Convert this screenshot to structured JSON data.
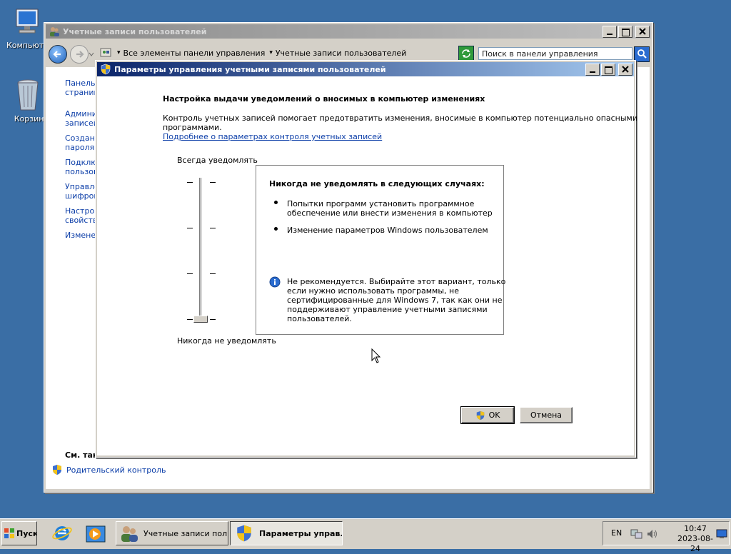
{
  "desktop": {
    "icons": [
      {
        "label": "Компьютер"
      },
      {
        "label": "Корзина"
      }
    ]
  },
  "cp_window": {
    "title": "Учетные записи пользователей",
    "breadcrumb": [
      "Все элементы панели управления",
      "Учетные записи пользователей"
    ],
    "search_placeholder": "Поиск в панели управления",
    "sidebar": [
      {
        "line1": "Панель",
        "line2": "страниц"
      },
      {
        "line1": "Админис",
        "line2": "записей"
      },
      {
        "line1": "Создани",
        "line2": "пароля"
      },
      {
        "line1": "Подклю",
        "line2": "пользов"
      },
      {
        "line1": "Управле",
        "line2": "шифров"
      },
      {
        "line1": "Настрой",
        "line2": "свойств"
      },
      {
        "line1": "Изменен",
        "line2": ""
      }
    ],
    "see_also": "См. так",
    "parental": "Родительский контроль"
  },
  "uac_dialog": {
    "title": "Параметры управления учетными записями пользователей",
    "heading": "Настройка выдачи уведомлений о вносимых в компьютер изменениях",
    "desc_line1": "Контроль учетных записей помогает предотвратить изменения, вносимые в компьютер потенциально опасными",
    "desc_line2": "программами.",
    "more_link": "Подробнее о параметрах контроля учетных записей",
    "slider_top": "Всегда уведомлять",
    "slider_bottom": "Никогда не уведомлять",
    "slider_level": 0,
    "slider_levels": 4,
    "info_title": "Никогда не уведомлять в следующих случаях:",
    "bullet1_line1": "Попытки программ установить программное",
    "bullet1_line2": "обеспечение или внести изменения в компьютер",
    "bullet2": "Изменение параметров Windows пользователем",
    "note_line1": "Не рекомендуется. Выбирайте этот вариант, только",
    "note_line2": "если нужно использовать программы, не",
    "note_line3": "сертифицированные для Windows 7, так как они не",
    "note_line4": "поддерживают управление учетными записями",
    "note_line5": "пользователей.",
    "ok": "OK",
    "cancel": "Отмена"
  },
  "taskbar": {
    "start": "Пуск",
    "tasks": [
      {
        "label": "Учетные записи пол..."
      },
      {
        "label": "Параметры управ..."
      }
    ],
    "lang": "EN",
    "time": "10:47",
    "date": "2023-08-24"
  },
  "colors": {
    "desktop": "#3a6ea5",
    "active_title": "#0a246a",
    "link": "#0c3ea8"
  }
}
